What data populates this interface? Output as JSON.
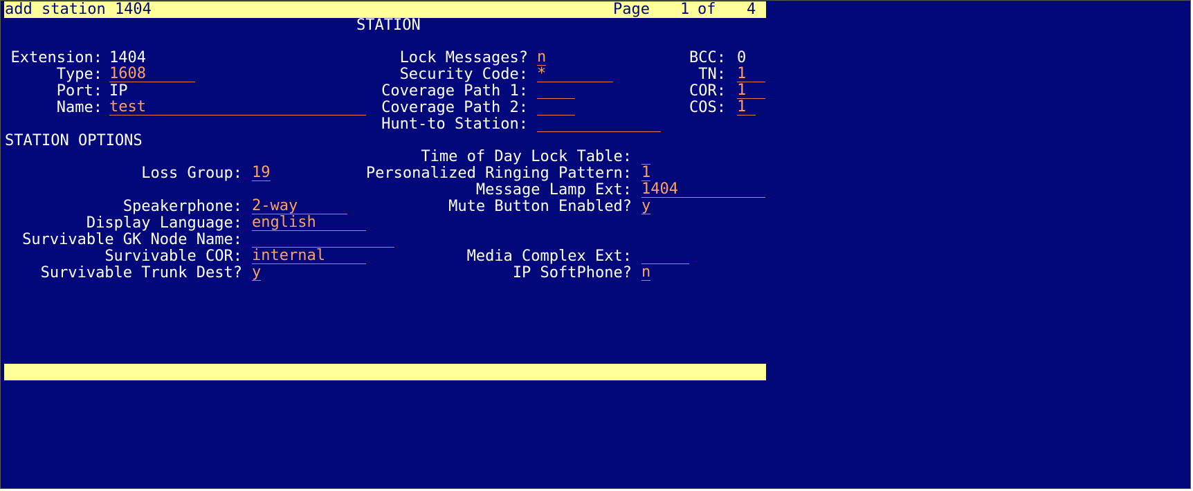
{
  "header": {
    "command": "add station 1404",
    "page_label": "Page",
    "page_current": "1",
    "page_of": "of",
    "page_total": "4"
  },
  "form_title": "STATION",
  "fields": {
    "extension": {
      "label": "Extension:",
      "value": "1404"
    },
    "type": {
      "label": "Type:",
      "value": "1608"
    },
    "port": {
      "label": "Port:",
      "value": "IP"
    },
    "name": {
      "label": "Name:",
      "value": "test"
    },
    "lock_messages": {
      "label": "Lock Messages?",
      "value": "n"
    },
    "security_code": {
      "label": "Security Code:",
      "value": "*"
    },
    "coverage_path_1": {
      "label": "Coverage Path 1:",
      "value": ""
    },
    "coverage_path_2": {
      "label": "Coverage Path 2:",
      "value": ""
    },
    "hunt_to_station": {
      "label": "Hunt-to Station:",
      "value": ""
    },
    "bcc": {
      "label": "BCC:",
      "value": "0"
    },
    "tn": {
      "label": "TN:",
      "value": "1"
    },
    "cor": {
      "label": "COR:",
      "value": "1"
    },
    "cos": {
      "label": "COS:",
      "value": "1"
    }
  },
  "station_options": {
    "heading": "STATION OPTIONS",
    "time_of_day_lock_table": {
      "label": "Time of Day Lock Table:",
      "value": ""
    },
    "loss_group": {
      "label": "Loss Group:",
      "value": "19"
    },
    "personalized_ringing_pattern": {
      "label": "Personalized Ringing Pattern:",
      "value": "1"
    },
    "message_lamp_ext": {
      "label": "Message Lamp Ext:",
      "value": "1404"
    },
    "speakerphone": {
      "label": "Speakerphone:",
      "value": "2-way"
    },
    "mute_button_enabled": {
      "label": "Mute Button Enabled?",
      "value": "y"
    },
    "display_language": {
      "label": "Display Language:",
      "value": "english"
    },
    "survivable_gk_node_name": {
      "label": "Survivable GK Node Name:",
      "value": ""
    },
    "survivable_cor": {
      "label": "Survivable COR:",
      "value": "internal"
    },
    "media_complex_ext": {
      "label": "Media Complex Ext:",
      "value": ""
    },
    "survivable_trunk_dest": {
      "label": "Survivable Trunk Dest?",
      "value": "y"
    },
    "ip_softphone": {
      "label": "IP SoftPhone?",
      "value": "n"
    }
  },
  "colors": {
    "background": "#00087a",
    "bar": "#ffff99",
    "label_text": "#ffffff",
    "field_text": "#ffa060"
  }
}
